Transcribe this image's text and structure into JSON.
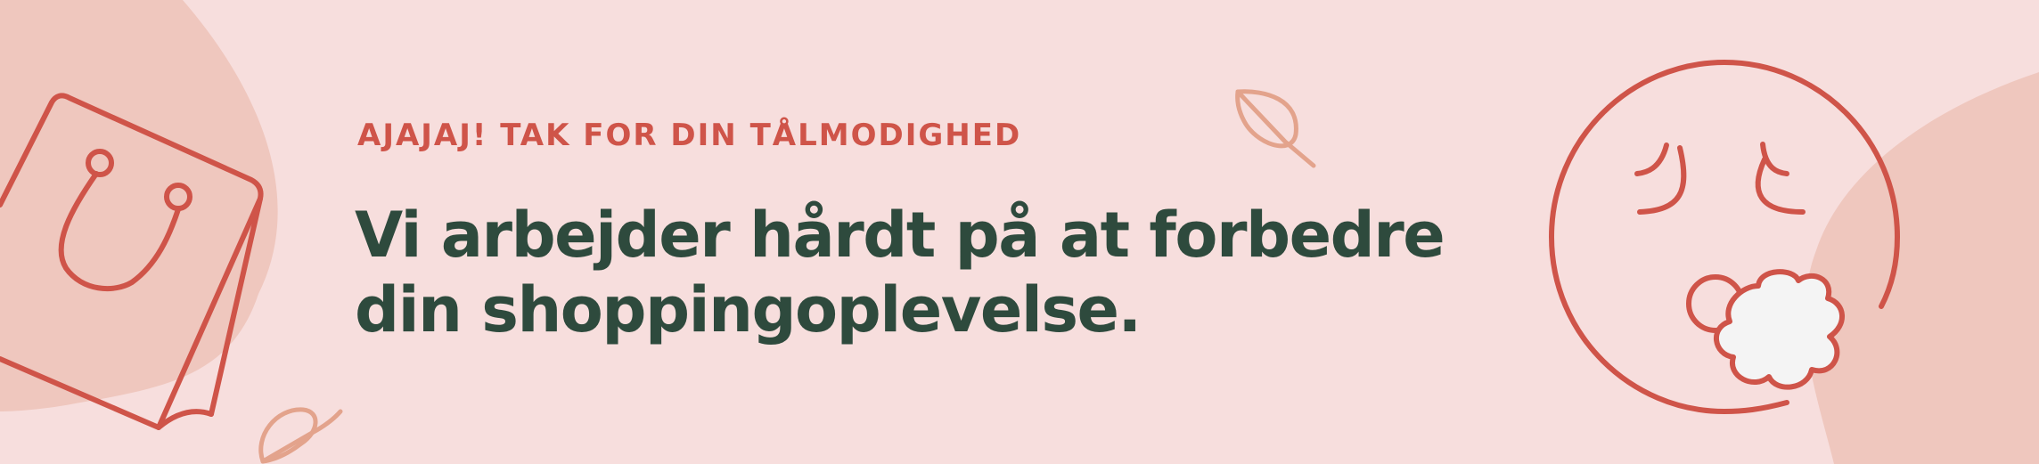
{
  "banner": {
    "eyebrow": "AJAJAJ! TAK FOR DIN TÅLMODIGHED",
    "headline_line1": "Vi arbejder hårdt på at forbedre",
    "headline_line2": "din shoppingoplevelse."
  },
  "icons": [
    "shopping-bag-icon",
    "leaf-icon",
    "sleepy-face-icon",
    "cloud-icon"
  ],
  "colors": {
    "background": "#f7dedd",
    "blob": "#efc7be",
    "accent": "#cf5449",
    "leaf": "#e3a38c",
    "headline": "#2e4a3d"
  }
}
